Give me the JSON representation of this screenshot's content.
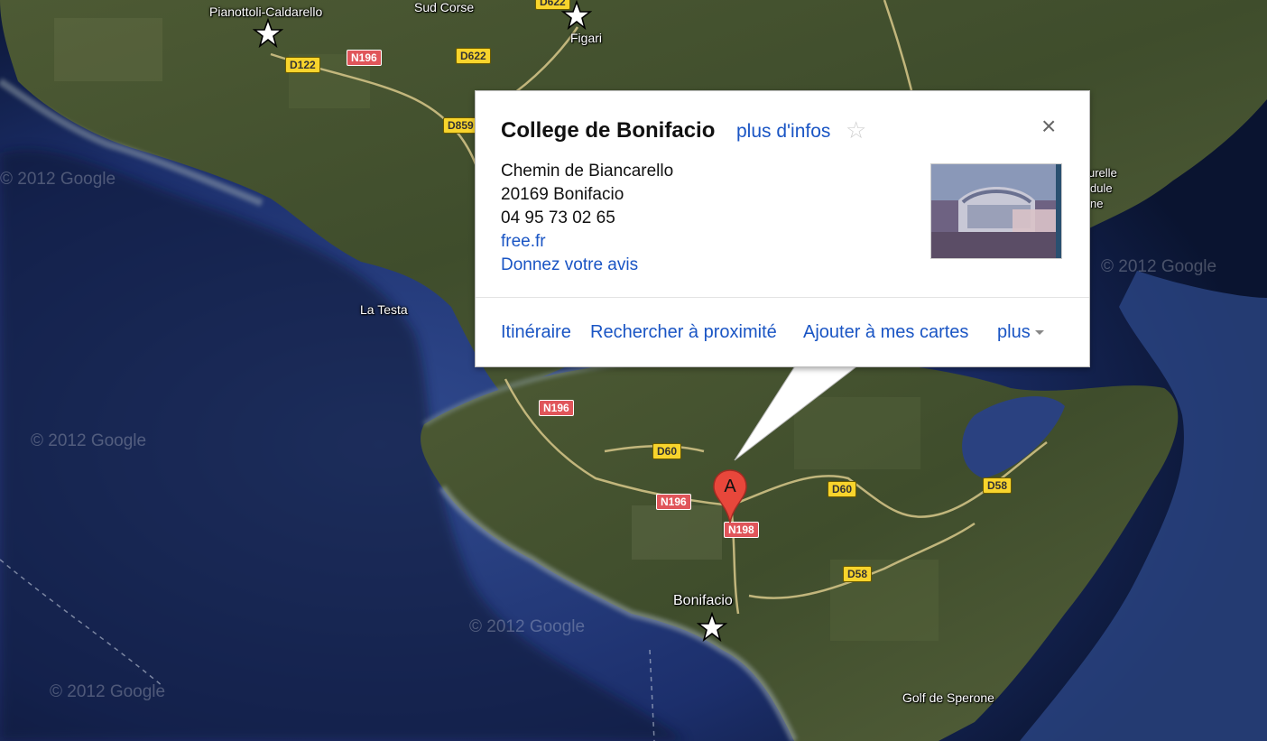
{
  "map": {
    "places": [
      {
        "name": "Pianottoli-Caldarello"
      },
      {
        "name": "Sud Corse"
      },
      {
        "name": "Figari"
      },
      {
        "name": "La Testa"
      },
      {
        "name": "Bonifacio"
      },
      {
        "name": "Golf de Sperone"
      },
      {
        "name": "urelle"
      },
      {
        "name": "dule"
      },
      {
        "name": "ne"
      }
    ],
    "roads": [
      {
        "label": "D122",
        "color": "yellow"
      },
      {
        "label": "N196",
        "color": "red"
      },
      {
        "label": "D622",
        "color": "yellow"
      },
      {
        "label": "D859",
        "color": "yellow"
      },
      {
        "label": "N196",
        "color": "red"
      },
      {
        "label": "D60",
        "color": "yellow"
      },
      {
        "label": "N196",
        "color": "red"
      },
      {
        "label": "N198",
        "color": "red"
      },
      {
        "label": "D60",
        "color": "yellow"
      },
      {
        "label": "D58",
        "color": "yellow"
      },
      {
        "label": "D58",
        "color": "yellow"
      },
      {
        "label": "D622",
        "color": "yellow"
      }
    ],
    "copyright": "© 2012 Google",
    "marker_label": "A"
  },
  "info": {
    "title": "College de Bonifacio",
    "more_info": "plus d'infos",
    "favorite_icon": "star-outline",
    "close_label": "×",
    "address_line1": "Chemin de Biancarello",
    "address_line2": "20169 Bonifacio",
    "phone": "04 95 73 02 65",
    "website": "free.fr",
    "review": "Donnez votre avis",
    "actions": {
      "directions": "Itinéraire",
      "search_nearby": "Rechercher à proximité",
      "add_to_maps": "Ajouter à mes cartes",
      "more": "plus"
    }
  },
  "colors": {
    "link": "#1a55c4",
    "marker": "#e8473b",
    "sea": "#1b2f6a"
  }
}
